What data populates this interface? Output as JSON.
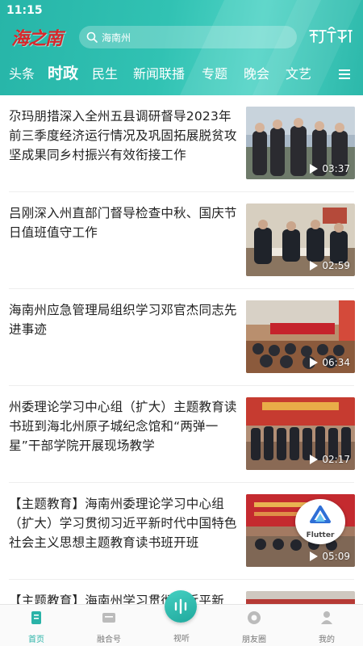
{
  "status": {
    "time": "11:15"
  },
  "header": {
    "logo_text": "海之南",
    "search_placeholder": "海南州",
    "tibetan_text": "ཚོད་ཡིག"
  },
  "tabs": [
    {
      "label": "头条"
    },
    {
      "label": "时政",
      "active": true
    },
    {
      "label": "民生"
    },
    {
      "label": "新闻联播"
    },
    {
      "label": "专题"
    },
    {
      "label": "晚会"
    },
    {
      "label": "文艺"
    }
  ],
  "articles": [
    {
      "title": "尕玛朋措深入全州五县调研督导2023年前三季度经济运行情况及巩固拓展脱贫攻坚成果同乡村振兴有效衔接工作",
      "duration": "03:37"
    },
    {
      "title": "吕刚深入州直部门督导检查中秋、国庆节日值班值守工作",
      "duration": "02:59"
    },
    {
      "title": "海南州应急管理局组织学习邓官杰同志先进事迹",
      "duration": "06:34"
    },
    {
      "title": "州委理论学习中心组（扩大）主题教育读书班到海北州原子城纪念馆和“两弹一星”干部学院开展现场教学",
      "duration": "02:17"
    },
    {
      "title": "【主题教育】海南州委理论学习中心组（扩大）学习贯彻习近平新时代中国特色社会主义思想主题教育读书班开班",
      "duration": "05:09"
    },
    {
      "title": "【主题教育】海南州学习贯彻习近平新",
      "duration": ""
    }
  ],
  "overlay": {
    "flutter_label": "Flutter"
  },
  "tabbar": {
    "home": "首页",
    "media": "融合号",
    "video": "视听",
    "friends": "朋友圈",
    "mine": "我的"
  },
  "colors": {
    "accent": "#2ab3a8",
    "logo_red": "#d9262b"
  }
}
